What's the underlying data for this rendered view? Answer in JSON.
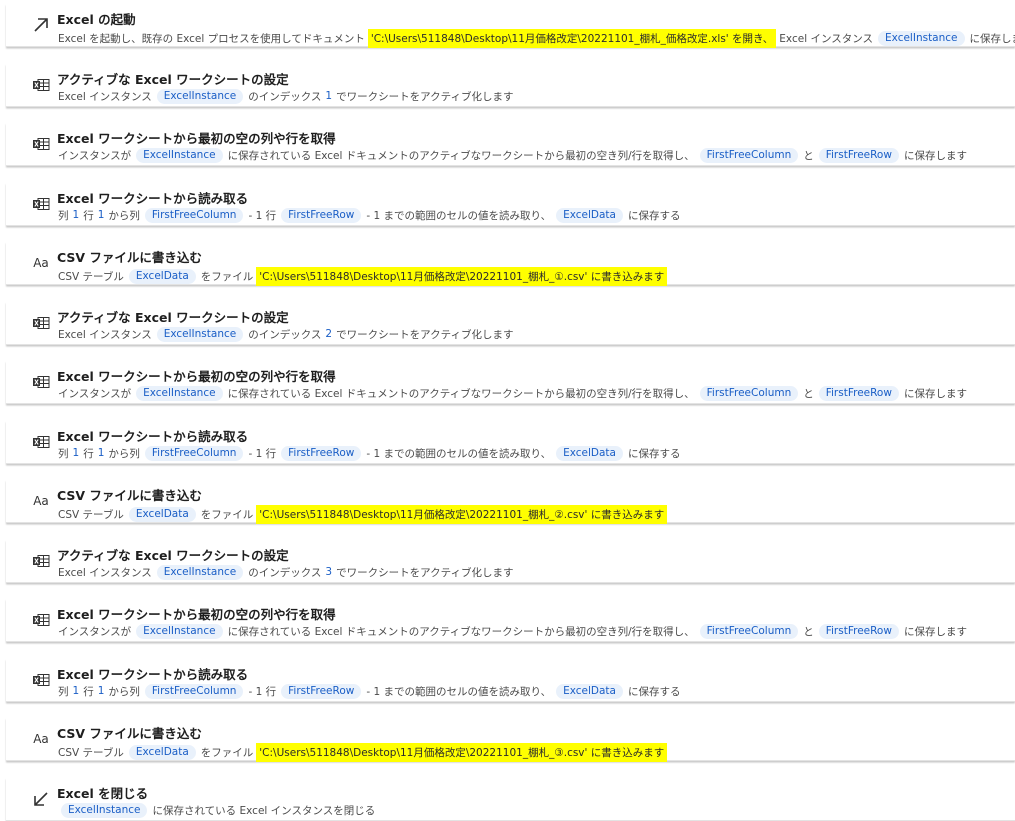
{
  "steps": [
    {
      "icon": "launch-arrow-icon",
      "title": "Excel の起動",
      "parts": [
        {
          "t": "text",
          "v": "Excel を起動し、既存の Excel プロセスを使用してドキュメント"
        },
        {
          "t": "hl",
          "v": "'C:\\Users\\511848\\Desktop\\11月価格改定\\20221101_棚札_価格改定.xls' を開き、"
        },
        {
          "t": "text",
          "v": "Excel インスタンス"
        },
        {
          "t": "pill",
          "v": "ExcelInstance"
        },
        {
          "t": "text",
          "v": "に保存します。"
        }
      ]
    },
    {
      "icon": "excel-sheet-icon",
      "title": "アクティブな Excel ワークシートの設定",
      "parts": [
        {
          "t": "text",
          "v": "Excel インスタンス"
        },
        {
          "t": "pill",
          "v": "ExcelInstance"
        },
        {
          "t": "text",
          "v": "のインデックス"
        },
        {
          "t": "num",
          "v": "1"
        },
        {
          "t": "text",
          "v": "でワークシートをアクティブ化します"
        }
      ]
    },
    {
      "icon": "excel-sheet-icon",
      "title": "Excel ワークシートから最初の空の列や行を取得",
      "parts": [
        {
          "t": "text",
          "v": "インスタンスが"
        },
        {
          "t": "pill",
          "v": "ExcelInstance"
        },
        {
          "t": "text",
          "v": "に保存されている Excel ドキュメントのアクティブなワークシートから最初の空き列/行を取得し、"
        },
        {
          "t": "pill",
          "v": "FirstFreeColumn"
        },
        {
          "t": "text",
          "v": "と"
        },
        {
          "t": "pill",
          "v": "FirstFreeRow"
        },
        {
          "t": "text",
          "v": "に保存します"
        }
      ]
    },
    {
      "icon": "excel-sheet-icon",
      "title": "Excel ワークシートから読み取る",
      "parts": [
        {
          "t": "text",
          "v": "列"
        },
        {
          "t": "num",
          "v": "1"
        },
        {
          "t": "text",
          "v": "行"
        },
        {
          "t": "num",
          "v": "1"
        },
        {
          "t": "text",
          "v": "から列"
        },
        {
          "t": "pill",
          "v": "FirstFreeColumn"
        },
        {
          "t": "text",
          "v": "- 1 行"
        },
        {
          "t": "pill",
          "v": "FirstFreeRow"
        },
        {
          "t": "text",
          "v": "- 1 までの範囲のセルの値を読み取り、"
        },
        {
          "t": "pill",
          "v": "ExcelData"
        },
        {
          "t": "text",
          "v": "に保存する"
        }
      ]
    },
    {
      "icon": "text-aa-icon",
      "title": "CSV ファイルに書き込む",
      "parts": [
        {
          "t": "text",
          "v": "CSV テーブル"
        },
        {
          "t": "pill",
          "v": "ExcelData"
        },
        {
          "t": "text",
          "v": "をファイル"
        },
        {
          "t": "hl",
          "v": "'C:\\Users\\511848\\Desktop\\11月価格改定\\20221101_棚札_①.csv' に書き込みます"
        }
      ]
    },
    {
      "icon": "excel-sheet-icon",
      "title": "アクティブな Excel ワークシートの設定",
      "parts": [
        {
          "t": "text",
          "v": "Excel インスタンス"
        },
        {
          "t": "pill",
          "v": "ExcelInstance"
        },
        {
          "t": "text",
          "v": "のインデックス"
        },
        {
          "t": "num",
          "v": "2"
        },
        {
          "t": "text",
          "v": "でワークシートをアクティブ化します"
        }
      ]
    },
    {
      "icon": "excel-sheet-icon",
      "title": "Excel ワークシートから最初の空の列や行を取得",
      "parts": [
        {
          "t": "text",
          "v": "インスタンスが"
        },
        {
          "t": "pill",
          "v": "ExcelInstance"
        },
        {
          "t": "text",
          "v": "に保存されている Excel ドキュメントのアクティブなワークシートから最初の空き列/行を取得し、"
        },
        {
          "t": "pill",
          "v": "FirstFreeColumn"
        },
        {
          "t": "text",
          "v": "と"
        },
        {
          "t": "pill",
          "v": "FirstFreeRow"
        },
        {
          "t": "text",
          "v": "に保存します"
        }
      ]
    },
    {
      "icon": "excel-sheet-icon",
      "title": "Excel ワークシートから読み取る",
      "parts": [
        {
          "t": "text",
          "v": "列"
        },
        {
          "t": "num",
          "v": "1"
        },
        {
          "t": "text",
          "v": "行"
        },
        {
          "t": "num",
          "v": "1"
        },
        {
          "t": "text",
          "v": "から列"
        },
        {
          "t": "pill",
          "v": "FirstFreeColumn"
        },
        {
          "t": "text",
          "v": "- 1 行"
        },
        {
          "t": "pill",
          "v": "FirstFreeRow"
        },
        {
          "t": "text",
          "v": "- 1 までの範囲のセルの値を読み取り、"
        },
        {
          "t": "pill",
          "v": "ExcelData"
        },
        {
          "t": "text",
          "v": "に保存する"
        }
      ]
    },
    {
      "icon": "text-aa-icon",
      "title": "CSV ファイルに書き込む",
      "parts": [
        {
          "t": "text",
          "v": "CSV テーブル"
        },
        {
          "t": "pill",
          "v": "ExcelData"
        },
        {
          "t": "text",
          "v": "をファイル"
        },
        {
          "t": "hl",
          "v": "'C:\\Users\\511848\\Desktop\\11月価格改定\\20221101_棚札_②.csv' に書き込みます"
        }
      ]
    },
    {
      "icon": "excel-sheet-icon",
      "title": "アクティブな Excel ワークシートの設定",
      "parts": [
        {
          "t": "text",
          "v": "Excel インスタンス"
        },
        {
          "t": "pill",
          "v": "ExcelInstance"
        },
        {
          "t": "text",
          "v": "のインデックス"
        },
        {
          "t": "num",
          "v": "3"
        },
        {
          "t": "text",
          "v": "でワークシートをアクティブ化します"
        }
      ]
    },
    {
      "icon": "excel-sheet-icon",
      "title": "Excel ワークシートから最初の空の列や行を取得",
      "parts": [
        {
          "t": "text",
          "v": "インスタンスが"
        },
        {
          "t": "pill",
          "v": "ExcelInstance"
        },
        {
          "t": "text",
          "v": "に保存されている Excel ドキュメントのアクティブなワークシートから最初の空き列/行を取得し、"
        },
        {
          "t": "pill",
          "v": "FirstFreeColumn"
        },
        {
          "t": "text",
          "v": "と"
        },
        {
          "t": "pill",
          "v": "FirstFreeRow"
        },
        {
          "t": "text",
          "v": "に保存します"
        }
      ]
    },
    {
      "icon": "excel-sheet-icon",
      "title": "Excel ワークシートから読み取る",
      "parts": [
        {
          "t": "text",
          "v": "列"
        },
        {
          "t": "num",
          "v": "1"
        },
        {
          "t": "text",
          "v": "行"
        },
        {
          "t": "num",
          "v": "1"
        },
        {
          "t": "text",
          "v": "から列"
        },
        {
          "t": "pill",
          "v": "FirstFreeColumn"
        },
        {
          "t": "text",
          "v": "- 1 行"
        },
        {
          "t": "pill",
          "v": "FirstFreeRow"
        },
        {
          "t": "text",
          "v": "- 1 までの範囲のセルの値を読み取り、"
        },
        {
          "t": "pill",
          "v": "ExcelData"
        },
        {
          "t": "text",
          "v": "に保存する"
        }
      ]
    },
    {
      "icon": "text-aa-icon",
      "title": "CSV ファイルに書き込む",
      "parts": [
        {
          "t": "text",
          "v": "CSV テーブル"
        },
        {
          "t": "pill",
          "v": "ExcelData"
        },
        {
          "t": "text",
          "v": "をファイル"
        },
        {
          "t": "hl",
          "v": "'C:\\Users\\511848\\Desktop\\11月価格改定\\20221101_棚札_③.csv' に書き込みます"
        }
      ]
    },
    {
      "icon": "close-arrow-icon",
      "title": "Excel を閉じる",
      "parts": [
        {
          "t": "pill",
          "v": "ExcelInstance"
        },
        {
          "t": "text",
          "v": "に保存されている Excel インスタンスを閉じる"
        }
      ]
    }
  ],
  "icon_glyphs": {
    "text_aa": "Aa"
  },
  "colors": {
    "highlight": "#ffff00",
    "pill_bg": "#e9f1fb",
    "pill_text": "#1a5ec6"
  }
}
